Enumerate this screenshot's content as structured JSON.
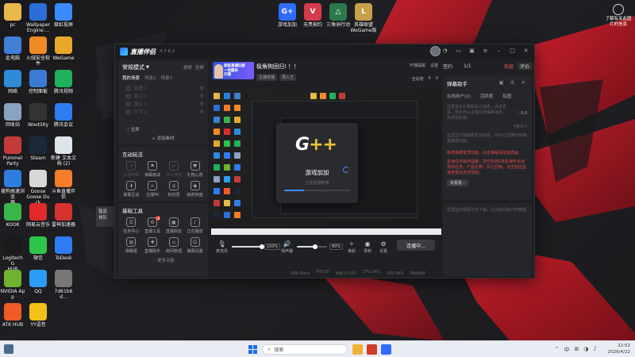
{
  "colors": {
    "accent_blue": "#2f6cff",
    "wallpaper_red": "#c1121f",
    "live_red": "#e34b4b",
    "gplus_yellow": "#f1c232"
  },
  "desktop_left": [
    {
      "label": "pc",
      "color": "#e8b84a"
    },
    {
      "label": "Wallpaper\nEngine:...",
      "color": "#2b6fd6"
    },
    {
      "label": "极虹投屏",
      "color": "#3a8bff"
    },
    {
      "label": "此电脑",
      "color": "#3f7fd6"
    },
    {
      "label": "火绒安全软件",
      "color": "#f08a24"
    },
    {
      "label": "WeGame",
      "color": "#e8a72a"
    },
    {
      "label": "网络",
      "color": "#2f8bd8"
    },
    {
      "label": "控制面板",
      "color": "#3c7bd4"
    },
    {
      "label": "腾讯视频",
      "color": "#1fb25a"
    },
    {
      "label": "回收站",
      "color": "#8aa3c2"
    },
    {
      "label": "Wootility",
      "color": "#333"
    },
    {
      "label": "腾讯会议",
      "color": "#2f7bf0"
    },
    {
      "label": "Pummel\nParty",
      "color": "#c43a3a"
    },
    {
      "label": "Steam",
      "color": "#1b2838"
    },
    {
      "label": "新建 文本文\n档 (2)",
      "color": "#dfe3ea"
    },
    {
      "label": "搜狗高速浏览\n器",
      "color": "#2e7de0"
    },
    {
      "label": "Goose\nGoose Duck",
      "color": "#d8d8d8"
    },
    {
      "label": "斗鱼直播伴侣",
      "color": "#f57c2a"
    },
    {
      "label": "KOOK",
      "color": "#3bb54a"
    },
    {
      "label": "网易云音乐",
      "color": "#e02a2a"
    },
    {
      "label": "雷神加速器",
      "color": "#d5332f"
    },
    {
      "label": "Logitech G\nHUB",
      "color": "#1a1a1a"
    },
    {
      "label": "微信",
      "color": "#2dc44b"
    },
    {
      "label": "ToDesk",
      "color": "#2d7cf5"
    },
    {
      "label": "NVIDIA App",
      "color": "#6fb22e"
    },
    {
      "label": "QQ",
      "color": "#2a9df4"
    },
    {
      "label": "7d61b6d...",
      "color": "#777"
    },
    {
      "label": "ATK HUB",
      "color": "#f05a28"
    },
    {
      "label": "YY语音",
      "color": "#f2c21b"
    }
  ],
  "desktop_top": [
    {
      "label": "游戏加加",
      "color": "#2f6cff",
      "glyph": "G+"
    },
    {
      "label": "无畏契约",
      "color": "#d43b4b",
      "glyph": "V"
    },
    {
      "label": "三角洲行动",
      "color": "#2c7a4a",
      "glyph": "△"
    },
    {
      "label": "英雄联盟\nWeGame版",
      "color": "#c8a04a",
      "glyph": "L"
    }
  ],
  "side_widget": {
    "label": "了解有关此图\n片的信息"
  },
  "app": {
    "title": "直播伴侣",
    "version": "4.7.8.2",
    "scene": {
      "mode": "常规模式",
      "mode_arrow": "▼",
      "side_right": "横屏",
      "side_right2": "竖屏",
      "tabs": [
        "我的场景",
        "场景2",
        "场景3"
      ],
      "sources": [
        "直播 1",
        "窗口 1",
        "图片 1",
        "文字 1"
      ],
      "full": "全屏",
      "add": "+ 添加素材"
    },
    "interact": {
      "title": "互动玩法",
      "tools": [
        {
          "label": "礼物特效",
          "glyph": "✦",
          "dim": true
        },
        {
          "label": "弹幕挑战",
          "glyph": "⚑",
          "dim": false
        },
        {
          "label": "多人连线",
          "glyph": "⇄",
          "dim": true
        },
        {
          "label": "礼物心愿",
          "glyph": "♥",
          "dim": false
        },
        {
          "label": "弹幕互动",
          "glyph": "⬇",
          "dim": false
        },
        {
          "label": "主播PK",
          "glyph": "⚔",
          "dim": false
        },
        {
          "label": "粉丝团",
          "glyph": "◎",
          "dim": false
        },
        {
          "label": "抽奖转盘",
          "glyph": "◉",
          "dim": false
        }
      ]
    },
    "basic": {
      "title": "基础工具",
      "tools": [
        {
          "label": "任务中心",
          "glyph": "☰"
        },
        {
          "label": "直播工具",
          "glyph": "⚙"
        },
        {
          "label": "直播商店",
          "glyph": "▣"
        },
        {
          "label": "正在播放",
          "glyph": "♪"
        },
        {
          "label": "弹幕姬",
          "glyph": "▤"
        },
        {
          "label": "直播助手",
          "glyph": "✚"
        },
        {
          "label": "房间管理",
          "glyph": "⌂"
        },
        {
          "label": "弹幕设置",
          "glyph": "☺"
        }
      ],
      "badge": "18",
      "more": "··· 更多功能"
    },
    "banner": {
      "image_text": "超级直播玩家\n一觉醒来\n开播",
      "title": "极角狗回归! ！！",
      "tags": [
        "主播安播",
        "录入王"
      ],
      "top_actions": [
        "开播提醒",
        "设置"
      ],
      "stats_actions": [
        "全站榜",
        "4",
        "0"
      ]
    },
    "preview": {
      "loading_logo_main": "G",
      "loading_logo_plus": "+",
      "loading_logo_plus2": "+",
      "loading_title": "游戏加加",
      "loading_sub": "正在检测环境",
      "progress": 0.3
    },
    "controls": {
      "mic_label": "麦克风",
      "mic_pct": "100%",
      "speaker_label": "扬声器",
      "speaker_pct": "60%",
      "mic_level": 1.0,
      "speaker_level": 0.6,
      "buttons": [
        "美颜",
        "录制",
        "设置"
      ],
      "go_live": "连播中..."
    },
    "stats": [
      "码率:0kb/s",
      "FPS:60",
      "丢帧:0.00%",
      "CPU:24%",
      "内存:68%",
      "网络良好"
    ],
    "right": {
      "top_label": "签约",
      "page": "1/1",
      "hot": "热度",
      "eval": "评价",
      "danmu_title": "弹幕助手",
      "danmu_icons": "▣ ⚙ ✕",
      "tabs": [
        "在线用户(2)",
        "活跃度",
        "贴图"
      ],
      "hint1": "这里显示礼物和关注消息，点击查看，您也可以设置礼物弹幕消息，并添加礼物。",
      "like": "♡ 0.0",
      "hint2": "这里显示弹幕和互动消息，也可以选择开启弹幕播报功能。",
      "hl_title": "新增弹幕置顶功能，点击弹幕添加进调画",
      "hl_body": "星海任务操作提醒：您已收到1条星海平台派发的任务，产品名称：风之回响，点击前往星海查看任务详情吧。",
      "see_more": "去看看 ›",
      "count": "0条/0人",
      "bottom_hint": "这里显示观看过你了解，以及房间用户的数据"
    }
  },
  "notice": {
    "line1": "猛兽",
    "line2": "排队"
  },
  "taskbar": {
    "search": "搜索",
    "time": "22:52",
    "date": "2026/4/22",
    "tray_glyphs": [
      "⌃",
      "中",
      "⊞",
      "◑",
      "♪"
    ]
  }
}
